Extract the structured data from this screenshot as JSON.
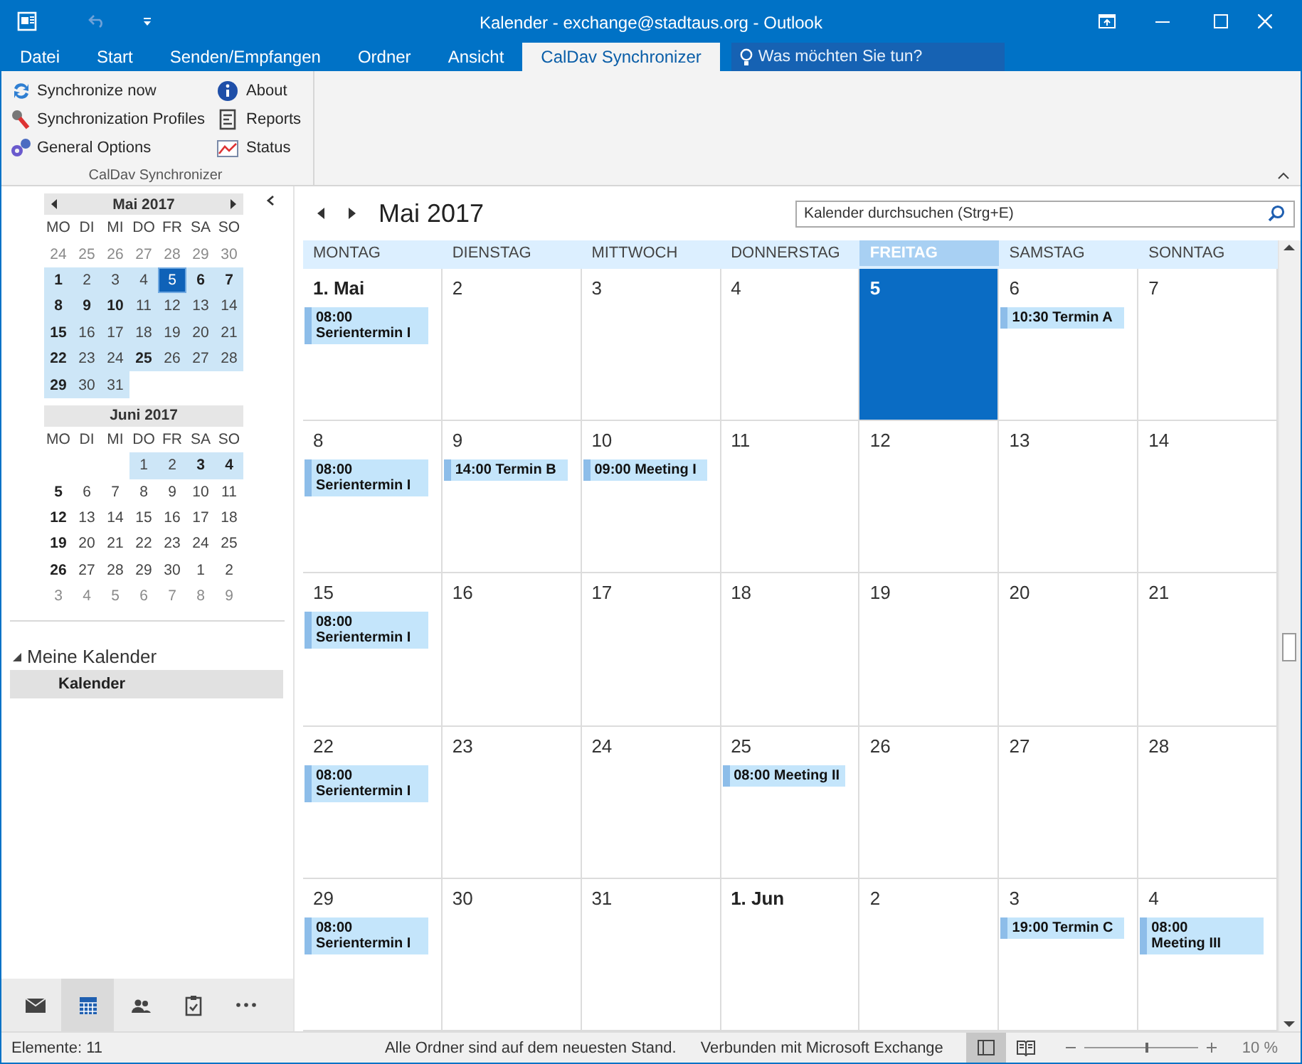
{
  "window": {
    "title": "Kalender - exchange@stadtaus.org - Outlook"
  },
  "tabs": [
    {
      "label": "Datei",
      "selected": false
    },
    {
      "label": "Start",
      "selected": false
    },
    {
      "label": "Senden/Empfangen",
      "selected": false
    },
    {
      "label": "Ordner",
      "selected": false
    },
    {
      "label": "Ansicht",
      "selected": false
    },
    {
      "label": "CalDav Synchronizer",
      "selected": true
    }
  ],
  "tell_me": {
    "placeholder": "Was möchten Sie tun?"
  },
  "ribbon": {
    "group_label": "CalDav Synchronizer",
    "buttons": [
      {
        "label": "Synchronize now",
        "kind": "sync"
      },
      {
        "label": "Synchronization Profiles",
        "kind": "profiles"
      },
      {
        "label": "General Options",
        "kind": "options"
      },
      {
        "label": "About",
        "kind": "about"
      },
      {
        "label": "Reports",
        "kind": "reports"
      },
      {
        "label": "Status",
        "kind": "status"
      }
    ]
  },
  "mini_calendars": [
    {
      "title": "Mai 2017",
      "navigation": true,
      "weekdays": [
        "MO",
        "DI",
        "MI",
        "DO",
        "FR",
        "SA",
        "SO"
      ],
      "weeks": [
        {
          "days": [
            {
              "d": "24",
              "bold": false,
              "highlighted": false,
              "selected": false,
              "dimmed": true
            },
            {
              "d": "25",
              "bold": false,
              "highlighted": false,
              "selected": false,
              "dimmed": true
            },
            {
              "d": "26",
              "bold": false,
              "highlighted": false,
              "selected": false,
              "dimmed": true
            },
            {
              "d": "27",
              "bold": false,
              "highlighted": false,
              "selected": false,
              "dimmed": true
            },
            {
              "d": "28",
              "bold": false,
              "highlighted": false,
              "selected": false,
              "dimmed": true
            },
            {
              "d": "29",
              "bold": false,
              "highlighted": false,
              "selected": false,
              "dimmed": true
            },
            {
              "d": "30",
              "bold": false,
              "highlighted": false,
              "selected": false,
              "dimmed": true
            }
          ]
        },
        {
          "days": [
            {
              "d": "1",
              "bold": true,
              "highlighted": true,
              "selected": false,
              "dimmed": false
            },
            {
              "d": "2",
              "bold": false,
              "highlighted": true,
              "selected": false,
              "dimmed": false
            },
            {
              "d": "3",
              "bold": false,
              "highlighted": true,
              "selected": false,
              "dimmed": false
            },
            {
              "d": "4",
              "bold": false,
              "highlighted": true,
              "selected": false,
              "dimmed": false
            },
            {
              "d": "5",
              "bold": false,
              "highlighted": true,
              "selected": true,
              "dimmed": false
            },
            {
              "d": "6",
              "bold": true,
              "highlighted": true,
              "selected": false,
              "dimmed": false
            },
            {
              "d": "7",
              "bold": true,
              "highlighted": true,
              "selected": false,
              "dimmed": false
            }
          ]
        },
        {
          "days": [
            {
              "d": "8",
              "bold": true,
              "highlighted": true,
              "selected": false,
              "dimmed": false
            },
            {
              "d": "9",
              "bold": true,
              "highlighted": true,
              "selected": false,
              "dimmed": false
            },
            {
              "d": "10",
              "bold": true,
              "highlighted": true,
              "selected": false,
              "dimmed": false
            },
            {
              "d": "11",
              "bold": false,
              "highlighted": true,
              "selected": false,
              "dimmed": false
            },
            {
              "d": "12",
              "bold": false,
              "highlighted": true,
              "selected": false,
              "dimmed": false
            },
            {
              "d": "13",
              "bold": false,
              "highlighted": true,
              "selected": false,
              "dimmed": false
            },
            {
              "d": "14",
              "bold": false,
              "highlighted": true,
              "selected": false,
              "dimmed": false
            }
          ]
        },
        {
          "days": [
            {
              "d": "15",
              "bold": true,
              "highlighted": true,
              "selected": false,
              "dimmed": false
            },
            {
              "d": "16",
              "bold": false,
              "highlighted": true,
              "selected": false,
              "dimmed": false
            },
            {
              "d": "17",
              "bold": false,
              "highlighted": true,
              "selected": false,
              "dimmed": false
            },
            {
              "d": "18",
              "bold": false,
              "highlighted": true,
              "selected": false,
              "dimmed": false
            },
            {
              "d": "19",
              "bold": false,
              "highlighted": true,
              "selected": false,
              "dimmed": false
            },
            {
              "d": "20",
              "bold": false,
              "highlighted": true,
              "selected": false,
              "dimmed": false
            },
            {
              "d": "21",
              "bold": false,
              "highlighted": true,
              "selected": false,
              "dimmed": false
            }
          ]
        },
        {
          "days": [
            {
              "d": "22",
              "bold": true,
              "highlighted": true,
              "selected": false,
              "dimmed": false
            },
            {
              "d": "23",
              "bold": false,
              "highlighted": true,
              "selected": false,
              "dimmed": false
            },
            {
              "d": "24",
              "bold": false,
              "highlighted": true,
              "selected": false,
              "dimmed": false
            },
            {
              "d": "25",
              "bold": true,
              "highlighted": true,
              "selected": false,
              "dimmed": false
            },
            {
              "d": "26",
              "bold": false,
              "highlighted": true,
              "selected": false,
              "dimmed": false
            },
            {
              "d": "27",
              "bold": false,
              "highlighted": true,
              "selected": false,
              "dimmed": false
            },
            {
              "d": "28",
              "bold": false,
              "highlighted": true,
              "selected": false,
              "dimmed": false
            }
          ]
        },
        {
          "days": [
            {
              "d": "29",
              "bold": true,
              "highlighted": true,
              "selected": false,
              "dimmed": false
            },
            {
              "d": "30",
              "bold": false,
              "highlighted": true,
              "selected": false,
              "dimmed": false
            },
            {
              "d": "31",
              "bold": false,
              "highlighted": true,
              "selected": false,
              "dimmed": false
            }
          ]
        }
      ]
    },
    {
      "title": "Juni 2017",
      "navigation": false,
      "weekdays": [
        "MO",
        "DI",
        "MI",
        "DO",
        "FR",
        "SA",
        "SO"
      ],
      "weeks": [
        {
          "days": [
            {
              "d": "1",
              "bold": false,
              "highlighted": true,
              "selected": false,
              "dimmed": false
            },
            {
              "d": "2",
              "bold": false,
              "highlighted": true,
              "selected": false,
              "dimmed": false
            },
            {
              "d": "3",
              "bold": true,
              "highlighted": true,
              "selected": false,
              "dimmed": false
            },
            {
              "d": "4",
              "bold": true,
              "highlighted": true,
              "selected": false,
              "dimmed": false
            }
          ]
        },
        {
          "days": [
            {
              "d": "5",
              "bold": true,
              "highlighted": false,
              "selected": false,
              "dimmed": false
            },
            {
              "d": "6",
              "bold": false,
              "highlighted": false,
              "selected": false,
              "dimmed": false
            },
            {
              "d": "7",
              "bold": false,
              "highlighted": false,
              "selected": false,
              "dimmed": false
            },
            {
              "d": "8",
              "bold": false,
              "highlighted": false,
              "selected": false,
              "dimmed": false
            },
            {
              "d": "9",
              "bold": false,
              "highlighted": false,
              "selected": false,
              "dimmed": false
            },
            {
              "d": "10",
              "bold": false,
              "highlighted": false,
              "selected": false,
              "dimmed": false
            },
            {
              "d": "11",
              "bold": false,
              "highlighted": false,
              "selected": false,
              "dimmed": false
            }
          ]
        },
        {
          "days": [
            {
              "d": "12",
              "bold": true,
              "highlighted": false,
              "selected": false,
              "dimmed": false
            },
            {
              "d": "13",
              "bold": false,
              "highlighted": false,
              "selected": false,
              "dimmed": false
            },
            {
              "d": "14",
              "bold": false,
              "highlighted": false,
              "selected": false,
              "dimmed": false
            },
            {
              "d": "15",
              "bold": false,
              "highlighted": false,
              "selected": false,
              "dimmed": false
            },
            {
              "d": "16",
              "bold": false,
              "highlighted": false,
              "selected": false,
              "dimmed": false
            },
            {
              "d": "17",
              "bold": false,
              "highlighted": false,
              "selected": false,
              "dimmed": false
            },
            {
              "d": "18",
              "bold": false,
              "highlighted": false,
              "selected": false,
              "dimmed": false
            }
          ]
        },
        {
          "days": [
            {
              "d": "19",
              "bold": true,
              "highlighted": false,
              "selected": false,
              "dimmed": false
            },
            {
              "d": "20",
              "bold": false,
              "highlighted": false,
              "selected": false,
              "dimmed": false
            },
            {
              "d": "21",
              "bold": false,
              "highlighted": false,
              "selected": false,
              "dimmed": false
            },
            {
              "d": "22",
              "bold": false,
              "highlighted": false,
              "selected": false,
              "dimmed": false
            },
            {
              "d": "23",
              "bold": false,
              "highlighted": false,
              "selected": false,
              "dimmed": false
            },
            {
              "d": "24",
              "bold": false,
              "highlighted": false,
              "selected": false,
              "dimmed": false
            },
            {
              "d": "25",
              "bold": false,
              "highlighted": false,
              "selected": false,
              "dimmed": false
            }
          ]
        },
        {
          "days": [
            {
              "d": "26",
              "bold": true,
              "highlighted": false,
              "selected": false,
              "dimmed": false
            },
            {
              "d": "27",
              "bold": false,
              "highlighted": false,
              "selected": false,
              "dimmed": false
            },
            {
              "d": "28",
              "bold": false,
              "highlighted": false,
              "selected": false,
              "dimmed": false
            },
            {
              "d": "29",
              "bold": false,
              "highlighted": false,
              "selected": false,
              "dimmed": false
            },
            {
              "d": "30",
              "bold": false,
              "highlighted": false,
              "selected": false,
              "dimmed": false
            },
            {
              "d": "1",
              "bold": false,
              "highlighted": false,
              "selected": false,
              "dimmed": false
            },
            {
              "d": "2",
              "bold": false,
              "highlighted": false,
              "selected": false,
              "dimmed": false
            }
          ]
        },
        {
          "days": [
            {
              "d": "3",
              "bold": false,
              "highlighted": false,
              "selected": false,
              "dimmed": true
            },
            {
              "d": "4",
              "bold": false,
              "highlighted": false,
              "selected": false,
              "dimmed": true
            },
            {
              "d": "5",
              "bold": false,
              "highlighted": false,
              "selected": false,
              "dimmed": true
            },
            {
              "d": "6",
              "bold": false,
              "highlighted": false,
              "selected": false,
              "dimmed": true
            },
            {
              "d": "7",
              "bold": false,
              "highlighted": false,
              "selected": false,
              "dimmed": true
            },
            {
              "d": "8",
              "bold": false,
              "highlighted": false,
              "selected": false,
              "dimmed": true
            },
            {
              "d": "9",
              "bold": false,
              "highlighted": false,
              "selected": false,
              "dimmed": true
            }
          ]
        }
      ]
    }
  ],
  "folders": {
    "group": "Meine Kalender",
    "expanded": true,
    "items": [
      {
        "label": "Kalender",
        "selected": true
      }
    ]
  },
  "nav_bar": [
    {
      "kind": "mail",
      "selected": false
    },
    {
      "kind": "calendar",
      "selected": true
    },
    {
      "kind": "people",
      "selected": false
    },
    {
      "kind": "tasks",
      "selected": false
    },
    {
      "kind": "more",
      "selected": false
    }
  ],
  "calendar": {
    "title": "Mai 2017",
    "search": {
      "placeholder": "Kalender durchsuchen (Strg+E)"
    },
    "columns": [
      {
        "label": "MONTAG",
        "selected": false
      },
      {
        "label": "DIENSTAG",
        "selected": false
      },
      {
        "label": "MITTWOCH",
        "selected": false
      },
      {
        "label": "DONNERSTAG",
        "selected": false
      },
      {
        "label": "FREITAG",
        "selected": true
      },
      {
        "label": "SAMSTAG",
        "selected": false
      },
      {
        "label": "SONNTAG",
        "selected": false
      }
    ],
    "weeks": [
      {
        "days": [
          {
            "label": "1. Mai",
            "bold": true,
            "selected": false,
            "events": [
              {
                "time": "08:00",
                "title": "Serientermin I"
              }
            ]
          },
          {
            "label": "2",
            "bold": false,
            "selected": false
          },
          {
            "label": "3",
            "bold": false,
            "selected": false
          },
          {
            "label": "4",
            "bold": false,
            "selected": false
          },
          {
            "label": "5",
            "bold": false,
            "selected": true
          },
          {
            "label": "6",
            "bold": false,
            "selected": false,
            "events": [
              {
                "time": "10:30",
                "title": "Termin A"
              }
            ]
          },
          {
            "label": "7",
            "bold": false,
            "selected": false
          }
        ]
      },
      {
        "days": [
          {
            "label": "8",
            "bold": false,
            "selected": false,
            "events": [
              {
                "time": "08:00",
                "title": "Serientermin I"
              }
            ]
          },
          {
            "label": "9",
            "bold": false,
            "selected": false,
            "events": [
              {
                "time": "14:00",
                "title": "Termin B"
              }
            ]
          },
          {
            "label": "10",
            "bold": false,
            "selected": false,
            "events": [
              {
                "time": "09:00",
                "title": "Meeting I"
              }
            ]
          },
          {
            "label": "11",
            "bold": false,
            "selected": false
          },
          {
            "label": "12",
            "bold": false,
            "selected": false
          },
          {
            "label": "13",
            "bold": false,
            "selected": false
          },
          {
            "label": "14",
            "bold": false,
            "selected": false
          }
        ]
      },
      {
        "days": [
          {
            "label": "15",
            "bold": false,
            "selected": false,
            "events": [
              {
                "time": "08:00",
                "title": "Serientermin I"
              }
            ]
          },
          {
            "label": "16",
            "bold": false,
            "selected": false
          },
          {
            "label": "17",
            "bold": false,
            "selected": false
          },
          {
            "label": "18",
            "bold": false,
            "selected": false
          },
          {
            "label": "19",
            "bold": false,
            "selected": false
          },
          {
            "label": "20",
            "bold": false,
            "selected": false
          },
          {
            "label": "21",
            "bold": false,
            "selected": false
          }
        ]
      },
      {
        "days": [
          {
            "label": "22",
            "bold": false,
            "selected": false,
            "events": [
              {
                "time": "08:00",
                "title": "Serientermin I"
              }
            ]
          },
          {
            "label": "23",
            "bold": false,
            "selected": false
          },
          {
            "label": "24",
            "bold": false,
            "selected": false
          },
          {
            "label": "25",
            "bold": false,
            "selected": false,
            "events": [
              {
                "time": "08:00",
                "title": "Meeting II"
              }
            ]
          },
          {
            "label": "26",
            "bold": false,
            "selected": false
          },
          {
            "label": "27",
            "bold": false,
            "selected": false
          },
          {
            "label": "28",
            "bold": false,
            "selected": false
          }
        ]
      },
      {
        "days": [
          {
            "label": "29",
            "bold": false,
            "selected": false,
            "events": [
              {
                "time": "08:00",
                "title": "Serientermin I"
              }
            ]
          },
          {
            "label": "30",
            "bold": false,
            "selected": false
          },
          {
            "label": "31",
            "bold": false,
            "selected": false
          },
          {
            "label": "1. Jun",
            "bold": true,
            "selected": false
          },
          {
            "label": "2",
            "bold": false,
            "selected": false
          },
          {
            "label": "3",
            "bold": false,
            "selected": false,
            "events": [
              {
                "time": "19:00",
                "title": "Termin C"
              }
            ]
          },
          {
            "label": "4",
            "bold": false,
            "selected": false,
            "events": [
              {
                "time": "08:00",
                "title": "Meeting III"
              }
            ]
          }
        ]
      }
    ]
  },
  "status_bar": {
    "items_count": "Elemente: 11",
    "sync_status": "Alle Ordner sind auf dem neuesten Stand.",
    "connection": "Verbunden mit Microsoft Exchange",
    "views": [
      {
        "kind": "normal",
        "selected": true
      },
      {
        "kind": "reading",
        "selected": false
      }
    ],
    "zoom": {
      "level": 0.55,
      "reading": "10 %"
    }
  }
}
